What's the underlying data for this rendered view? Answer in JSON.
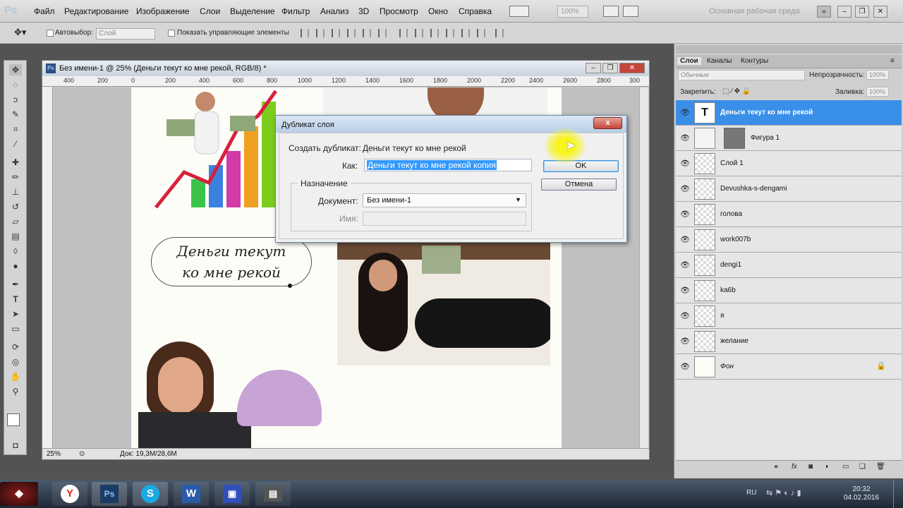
{
  "app": {
    "logo": "Ps"
  },
  "menu": [
    "Файл",
    "Редактирование",
    "Изображение",
    "Слои",
    "Выделение",
    "Фильтр",
    "Анализ",
    "3D",
    "Просмотр",
    "Окно",
    "Справка"
  ],
  "menubar": {
    "zoom": "100%",
    "workspace": "Основная рабочая среда"
  },
  "options": {
    "autoselect_label": "Автовыбор:",
    "layer_select": "Слой",
    "show_controls_label": "Показать управляющие элементы"
  },
  "document": {
    "title": "Без имени-1 @ 25% (Деньги текут ко мне рекой, RGB/8) *",
    "ruler": [
      "400",
      "200",
      "0",
      "200",
      "400",
      "600",
      "800",
      "1000",
      "1200",
      "1400",
      "1600",
      "1800",
      "2000",
      "2200",
      "2400",
      "2600",
      "2800",
      "300"
    ],
    "zoom": "25%",
    "size": "Док: 19,3M/28,6M",
    "speech_line1": "Деньги текут",
    "speech_line2": "ко мне рекой"
  },
  "dialog": {
    "title": "Дубликат слоя",
    "duplicate_label": "Создать дубликат:",
    "duplicate_value": "Деньги текут ко мне рекой",
    "as_label": "Как:",
    "as_value": "Деньги текут ко мне рекой копия",
    "group_label": "Назначение",
    "doc_label": "Документ:",
    "doc_value": "Без имени-1",
    "name_label": "Имя:",
    "ok": "OK",
    "cancel": "Отмена",
    "close": "x"
  },
  "panel": {
    "tabs": [
      "Слои",
      "Каналы",
      "Контуры"
    ],
    "blend_mode": "Обычные",
    "opacity_label": "Непрозрачность:",
    "opacity": "100%",
    "lock_label": "Закрепить:",
    "fill_label": "Заливка:",
    "fill": "100%",
    "layers": [
      {
        "name": "Деньги текут ко мне рекой",
        "type": "text",
        "selected": true
      },
      {
        "name": "Фигура 1",
        "type": "shape"
      },
      {
        "name": "Слой 1",
        "type": "pixel"
      },
      {
        "name": "Devushka-s-dengami",
        "type": "smart"
      },
      {
        "name": "голова",
        "type": "pixel"
      },
      {
        "name": "work007b",
        "type": "smart"
      },
      {
        "name": "dengi1",
        "type": "pixel"
      },
      {
        "name": "ka6b",
        "type": "smart"
      },
      {
        "name": "я",
        "type": "pixel"
      },
      {
        "name": "желание",
        "type": "smart"
      },
      {
        "name": "Фон",
        "type": "background",
        "locked": true
      }
    ]
  },
  "taskbar": {
    "apps": [
      "yandex-browser",
      "photoshop",
      "skype",
      "word",
      "save",
      "printer"
    ],
    "lang": "RU",
    "time": "20:32",
    "date": "04.02.2016"
  },
  "colors": {
    "selection": "#3a8fe8",
    "ok_focus": "#3d8fd6",
    "close_red": "#c4463a"
  }
}
